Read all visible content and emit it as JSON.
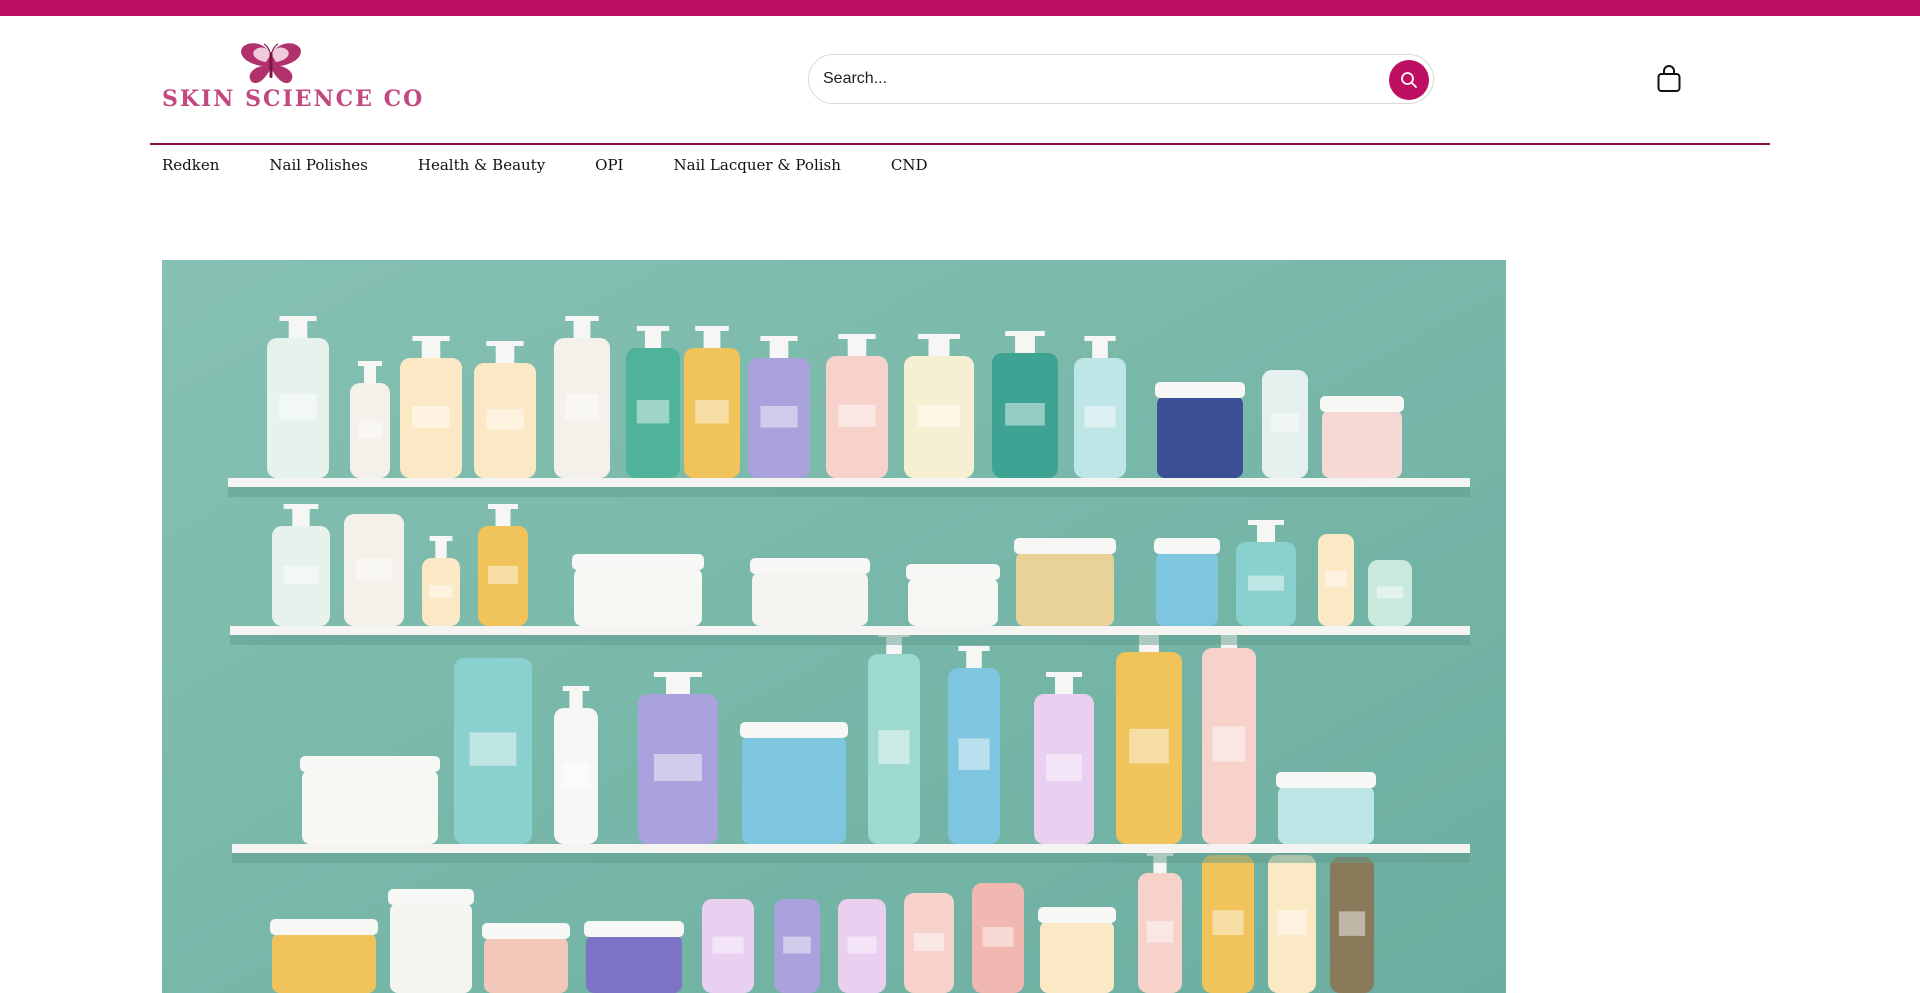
{
  "brand": {
    "name": "SKIN SCIENCE CO",
    "logo_icon": "butterfly-icon",
    "color": "#c2497f"
  },
  "colors": {
    "accent": "#be0f62",
    "divider": "#8f0c4a",
    "hero_background": "#7fbcae"
  },
  "search": {
    "placeholder": "Search...",
    "button_icon": "search-icon"
  },
  "cart": {
    "icon": "shopping-bag-icon"
  },
  "nav": {
    "items": [
      {
        "label": "Redken"
      },
      {
        "label": "Nail Polishes"
      },
      {
        "label": "Health & Beauty"
      },
      {
        "label": "OPI"
      },
      {
        "label": "Nail Lacquer & Polish"
      },
      {
        "label": "CND"
      }
    ]
  },
  "hero": {
    "image": "skincare-products-on-shelves"
  }
}
